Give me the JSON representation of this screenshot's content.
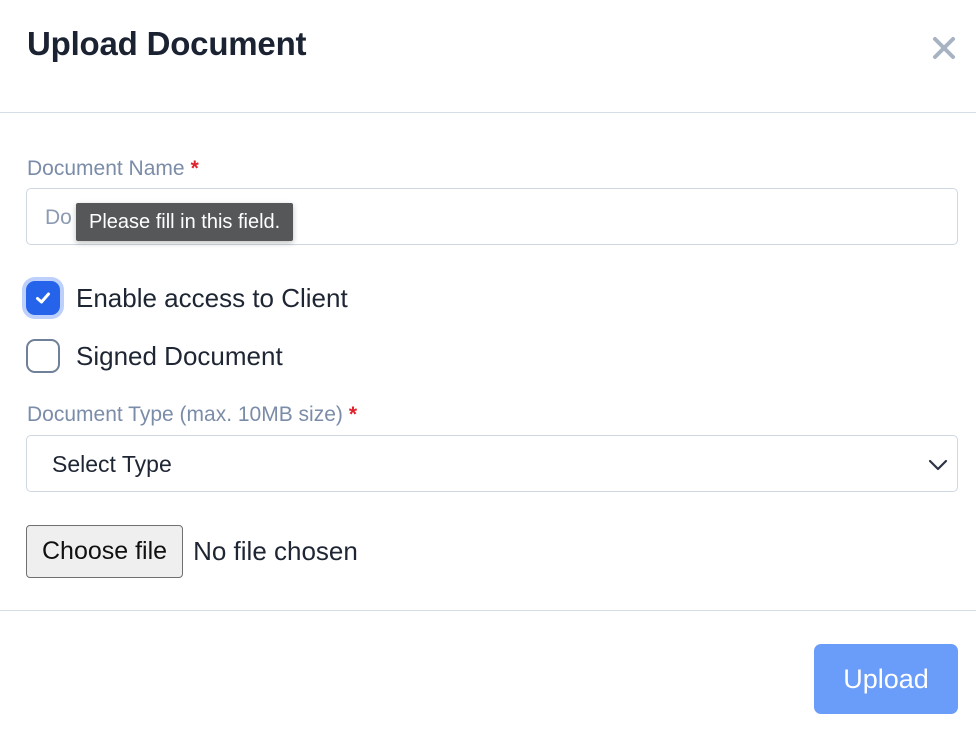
{
  "modal": {
    "title": "Upload Document",
    "close_icon": "close-icon"
  },
  "form": {
    "document_name": {
      "label": "Document Name",
      "required_mark": "*",
      "placeholder": "Do",
      "value": ""
    },
    "validation_tooltip": "Please fill in this field.",
    "enable_access": {
      "label": "Enable access to Client",
      "checked": true
    },
    "signed_document": {
      "label": "Signed Document",
      "checked": false
    },
    "document_type": {
      "label": "Document Type (max. 10MB size)",
      "required_mark": "*",
      "selected": "Select Type",
      "icon": "chevron-down-icon"
    },
    "file": {
      "button_label": "Choose file",
      "status": "No file chosen"
    }
  },
  "footer": {
    "upload_label": "Upload"
  },
  "colors": {
    "accent": "#2563eb",
    "upload_button": "#6a9cfa",
    "label": "#7b8ca9",
    "required": "#e0202a",
    "tooltip_bg": "#555759"
  }
}
